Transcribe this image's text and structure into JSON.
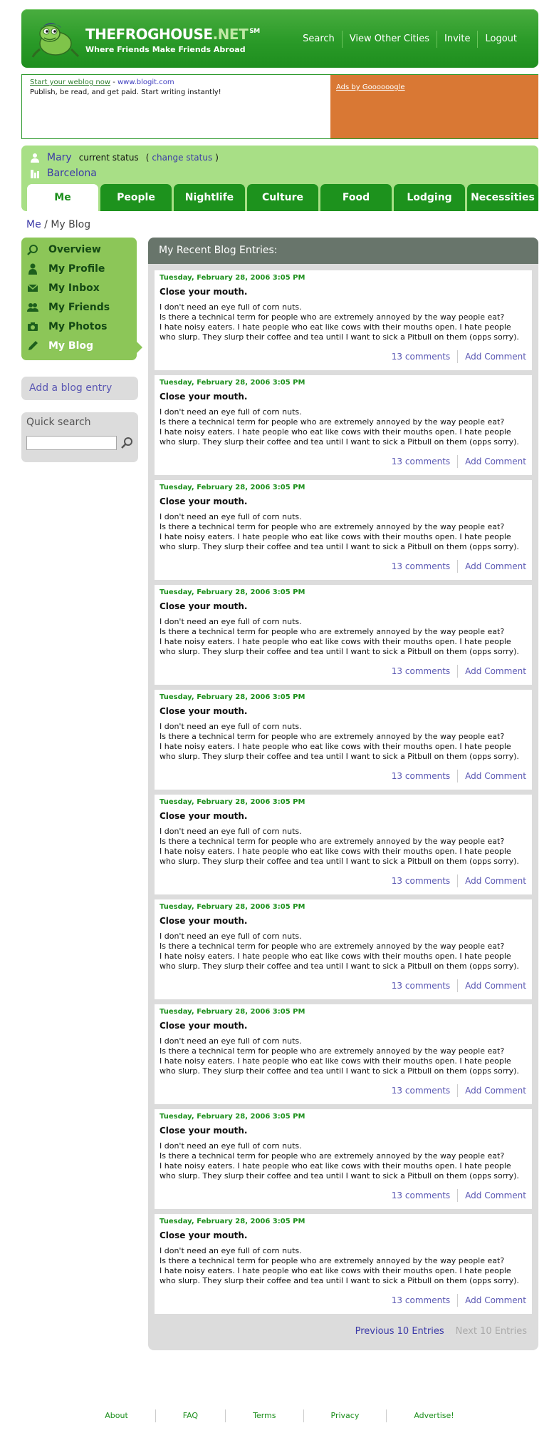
{
  "brand": {
    "name": "THEFROGHOUSE",
    "name_suffix": ".NET",
    "mark": "SM",
    "tagline": "Where Friends Make Friends Abroad"
  },
  "top_nav": [
    "Search",
    "View Other Cities",
    "Invite",
    "Logout"
  ],
  "ad": {
    "link_text": "Start your weblog now",
    "sep": " - ",
    "url": "www.blogit.com",
    "body": "Publish, be read, and get paid. Start writing instantly!",
    "ads_by": "Ads by Goooooogle"
  },
  "profile": {
    "name": "Mary",
    "status_label": "current status",
    "open_paren": "(",
    "change_status": "change status",
    "close_paren": ")",
    "city": "Barcelona"
  },
  "tabs": [
    "Me",
    "People",
    "Nightlife",
    "Culture",
    "Food",
    "Lodging",
    "Necessities"
  ],
  "breadcrumb": {
    "root": "Me",
    "sep": " / ",
    "current": "My Blog"
  },
  "sidebar": {
    "items": [
      "Overview",
      "My Profile",
      "My Inbox",
      "My Friends",
      "My Photos",
      "My Blog"
    ]
  },
  "add_blog": "Add a blog entry",
  "quick_search": {
    "title": "Quick search",
    "value": ""
  },
  "main": {
    "title": "My Recent Blog Entries:",
    "entries": [
      {
        "date": "Tuesday, February 28, 2006 3:05 PM",
        "title": "Close your mouth.",
        "lines": [
          "I don't need an eye full of corn nuts.",
          "Is there a technical term for people who are extremely annoyed by the way people eat?",
          "I hate noisy eaters. I hate people who eat like cows with their mouths open. I hate people",
          "who slurp. They slurp their coffee and tea until I want to sick a Pitbull on them (opps sorry)."
        ],
        "comments": "13 comments",
        "add_comment": "Add Comment"
      }
    ],
    "pager": {
      "prev": "Previous 10 Entries",
      "next": "Next 10 Entries"
    }
  },
  "footer": [
    "About",
    "FAQ",
    "Terms",
    "Privacy",
    "Advertise!"
  ],
  "colors": {
    "brand_green": "#2a9a28",
    "light_green": "#a8df86",
    "link_purple": "#3c3aa8",
    "ad_orange": "#d97834",
    "panel_header": "#68756b"
  }
}
